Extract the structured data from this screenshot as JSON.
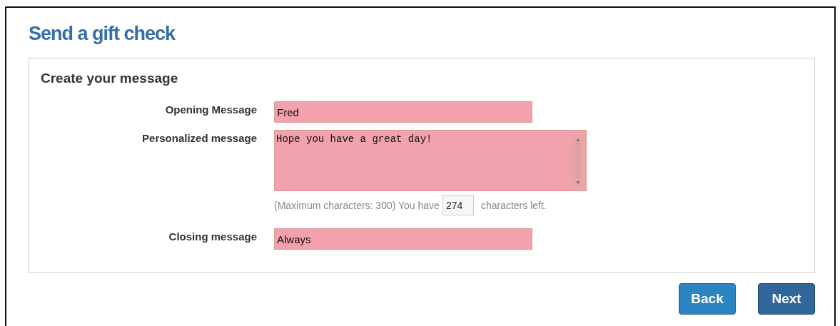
{
  "title": "Send a gift check",
  "panel": {
    "heading": "Create your message",
    "fields": [
      {
        "kind": "input",
        "label": "Opening Message",
        "value": "Fred"
      },
      {
        "kind": "textarea",
        "label": "Personalized message",
        "value": "Hope you have a great day!",
        "hint_before": "(Maximum characters: 300) You have",
        "count": "274",
        "hint_after": "characters left."
      },
      {
        "kind": "input",
        "label": "Closing message",
        "value": "Always"
      }
    ]
  },
  "buttons": [
    {
      "label": "Back",
      "kind": "secondary"
    },
    {
      "label": "Next",
      "kind": "primary"
    }
  ]
}
